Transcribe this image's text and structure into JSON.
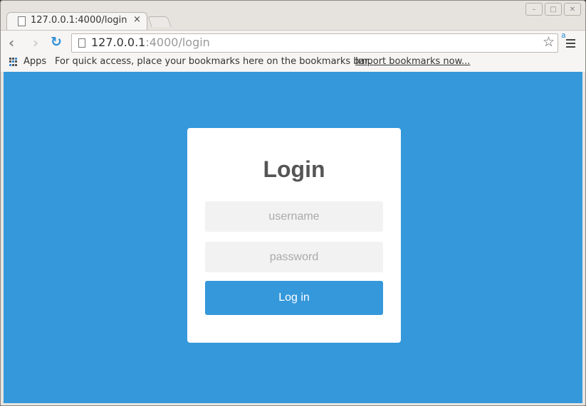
{
  "browser": {
    "tab": {
      "title": "127.0.0.1:4000/login",
      "close": "×"
    },
    "window_controls": {
      "minimize": "–",
      "maximize": "□",
      "close": "✕"
    },
    "nav": {
      "back": "‹",
      "forward": "›",
      "reload": "↻"
    },
    "url": {
      "host": "127.0.0.1",
      "rest": ":4000/login"
    },
    "star": "☆",
    "extension_badge": "a",
    "bookmarks": {
      "apps_label": "Apps",
      "message": "For quick access, place your bookmarks here on the bookmarks bar.",
      "import_link": "Import bookmarks now..."
    }
  },
  "page": {
    "background_color": "#3498db",
    "login": {
      "title": "Login",
      "username_placeholder": "username",
      "password_placeholder": "password",
      "submit_label": "Log in"
    }
  }
}
